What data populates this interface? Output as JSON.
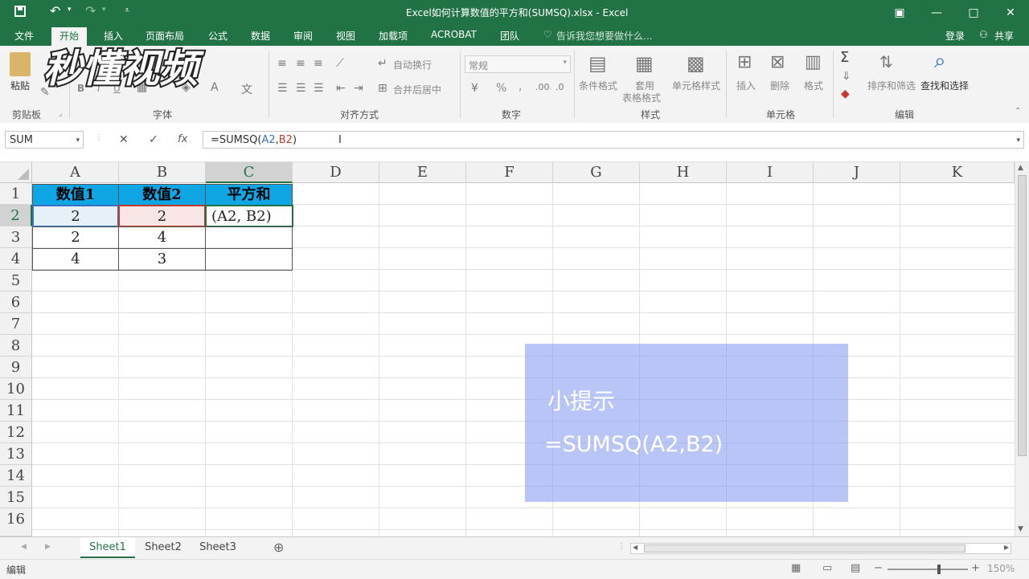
{
  "titlebar": {
    "title": "Excel如何计算数值的平方和(SUMSQ).xlsx - Excel",
    "save_icon": "save-icon",
    "undo_icon": "undo-icon",
    "redo_icon": "redo-icon",
    "qat_more": "customize-icon",
    "ribbon_display": "▣",
    "minimize": "—",
    "maximize": "□",
    "close": "✕"
  },
  "tabs": [
    {
      "label": "文件"
    },
    {
      "label": "开始"
    },
    {
      "label": "插入"
    },
    {
      "label": "页面布局"
    },
    {
      "label": "公式"
    },
    {
      "label": "数据"
    },
    {
      "label": "审阅"
    },
    {
      "label": "视图"
    },
    {
      "label": "加载项"
    },
    {
      "label": "ACROBAT"
    },
    {
      "label": "团队"
    }
  ],
  "tell_me": "告诉我您想要做什么...",
  "login": "登录",
  "share": "共享",
  "ribbon": {
    "paste": "粘贴",
    "groups": {
      "clipboard": "剪贴板",
      "font": "字体",
      "alignment": "对齐方式",
      "number": "数字",
      "styles": "样式",
      "cells": "单元格",
      "editing": "编辑"
    },
    "font_buttons": {
      "bold": "B",
      "italic": "I",
      "underline": "U"
    },
    "wrap_text": "自动换行",
    "merge_center": "合并后居中",
    "number_format": "常规",
    "number_symbols": {
      "percent": "%",
      "comma": ","
    },
    "conditional_format": "条件格式",
    "table_format_1": "套用",
    "table_format_2": "表格格式",
    "cell_styles": "单元格样式",
    "insert": "插入",
    "delete": "删除",
    "format": "格式",
    "sort_filter": "排序和筛选",
    "find_select": "查找和选择"
  },
  "formula_bar": {
    "name_box": "SUM",
    "cancel": "✕",
    "enter": "✓",
    "fx": "fx",
    "prefix": "=SUMSQ(",
    "ref1": "A2",
    "comma": ",",
    "ref2": "B2",
    "suffix": ")"
  },
  "columns": [
    "A",
    "B",
    "C",
    "D",
    "E",
    "F",
    "G",
    "H",
    "I",
    "J",
    "K"
  ],
  "rows": [
    "1",
    "2",
    "3",
    "4",
    "5",
    "6",
    "7",
    "8",
    "9",
    "10",
    "11",
    "12",
    "13",
    "14",
    "15",
    "16"
  ],
  "cells": {
    "A1": "数值1",
    "B1": "数值2",
    "C1": "平方和",
    "A2": "2",
    "B2": "2",
    "C2": "(A2, B2)",
    "A3": "2",
    "B3": "4",
    "A4": "4",
    "B4": "3"
  },
  "tip": {
    "title": "小提示",
    "formula": "=SUMSQ(A2,B2)"
  },
  "sheets": [
    {
      "label": "Sheet1"
    },
    {
      "label": "Sheet2"
    },
    {
      "label": "Sheet3"
    }
  ],
  "add_sheet": "⊕",
  "status": {
    "mode": "编辑",
    "zoom": "150%"
  },
  "watermark": "秒懂视频",
  "colors": {
    "excel_green": "#217346",
    "header_blue": "#0fa6e6",
    "tip_bg": "#97a7f2"
  }
}
